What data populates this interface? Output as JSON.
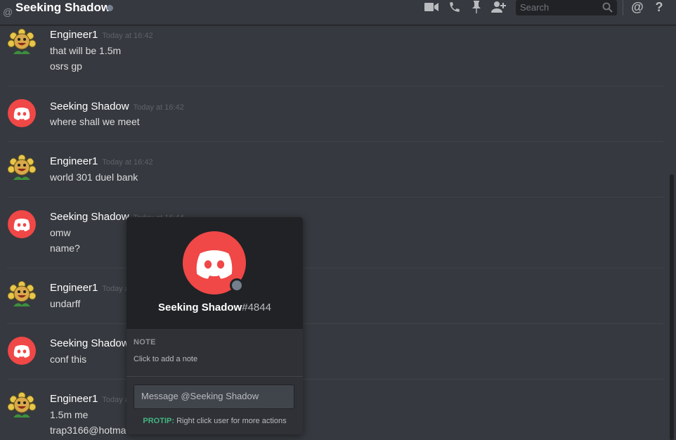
{
  "header": {
    "at_symbol": "@",
    "title": "Seeking Shadow",
    "search_placeholder": "Search",
    "icons": [
      "video-call-icon",
      "voice-call-icon",
      "pin-icon",
      "add-friend-icon",
      "search-icon",
      "mention-icon",
      "help-icon"
    ],
    "mention_glyph": "@",
    "help_glyph": "?"
  },
  "messages": [
    {
      "author": "Engineer1",
      "time": "Today at 16:42",
      "lines": [
        "that will be 1.5m",
        "osrs gp"
      ],
      "avatar": "flower"
    },
    {
      "author": "Seeking Shadow",
      "time": "Today at 16:42",
      "lines": [
        "where shall we meet"
      ],
      "avatar": "discord-red"
    },
    {
      "author": "Engineer1",
      "time": "Today at 16:42",
      "lines": [
        "world 301 duel bank"
      ],
      "avatar": "flower"
    },
    {
      "author": "Seeking Shadow",
      "time": "Today at 16:44",
      "lines": [
        "omw",
        "name?"
      ],
      "avatar": "discord-red"
    },
    {
      "author": "Engineer1",
      "time": "Today at 16:44",
      "lines": [
        "undarff"
      ],
      "avatar": "flower"
    },
    {
      "author": "Seeking Shadow",
      "time": "",
      "lines": [
        "conf this"
      ],
      "avatar": "discord-red"
    },
    {
      "author": "Engineer1",
      "time": "Today at 16:45",
      "lines": [
        "1.5m me",
        "trap3166@hotma"
      ],
      "avatar": "flower"
    }
  ],
  "popout": {
    "username": "Seeking Shadow",
    "discriminator": "#4844",
    "note_header": "NOTE",
    "note_placeholder": "Click to add a note",
    "message_placeholder": "Message @Seeking Shadow",
    "protip_label": "PROTIP:",
    "protip_text": " Right click user for more actions"
  },
  "colors": {
    "background": "#36393f",
    "popout_dark": "#202225",
    "discord_red": "#f04747",
    "offline_gray": "#747f8d",
    "protip_green": "#43b581"
  }
}
